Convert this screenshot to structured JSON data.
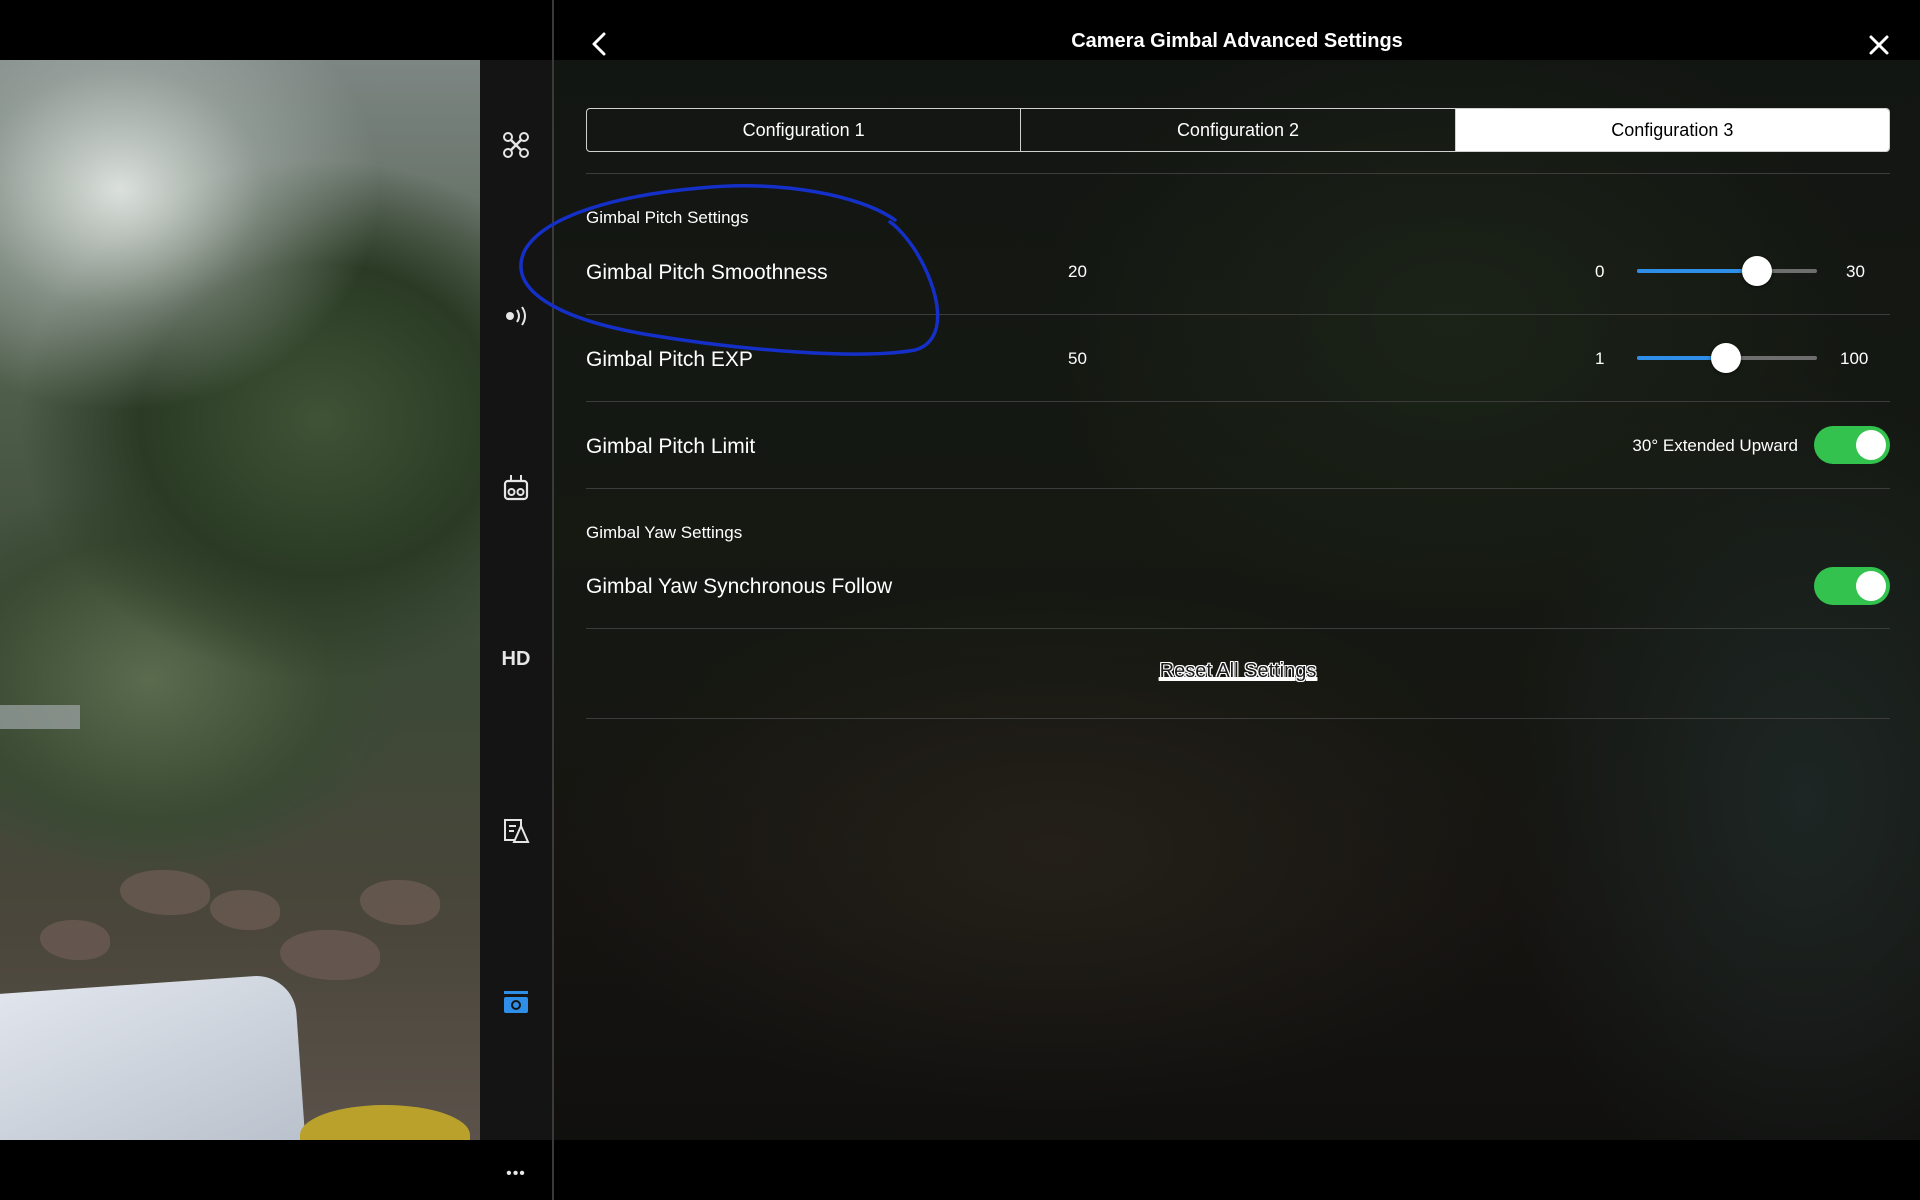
{
  "header": {
    "title": "Camera Gimbal Advanced Settings"
  },
  "tabs": [
    {
      "label": "Configuration 1",
      "active": false
    },
    {
      "label": "Configuration 2",
      "active": false
    },
    {
      "label": "Configuration 3",
      "active": true
    }
  ],
  "pitch_section": {
    "title": "Gimbal Pitch Settings",
    "smoothness": {
      "label": "Gimbal Pitch Smoothness",
      "value": "20",
      "min": "0",
      "max": "30",
      "fraction": 0.667
    },
    "exp": {
      "label": "Gimbal Pitch EXP",
      "value": "50",
      "min": "1",
      "max": "100",
      "fraction": 0.495
    },
    "limit": {
      "label": "Gimbal Pitch Limit",
      "option_text": "30° Extended Upward",
      "enabled": true
    }
  },
  "yaw_section": {
    "title": "Gimbal Yaw Settings",
    "sync_follow": {
      "label": "Gimbal Yaw Synchronous Follow",
      "enabled": true
    }
  },
  "reset_label": "Reset All Settings",
  "sidebar_icons": [
    "aircraft-icon",
    "signal-icon",
    "remote-controller-icon",
    "hd-icon",
    "map-sign-icon",
    "camera-icon",
    "more-icon"
  ],
  "sidebar_hd_text": "HD",
  "sidebar_more_text": "•••",
  "colors": {
    "accent": "#2e8ee8",
    "toggle_on": "#33c24d",
    "active_icon": "#2e8ee8",
    "annotation": "#1530c8"
  }
}
